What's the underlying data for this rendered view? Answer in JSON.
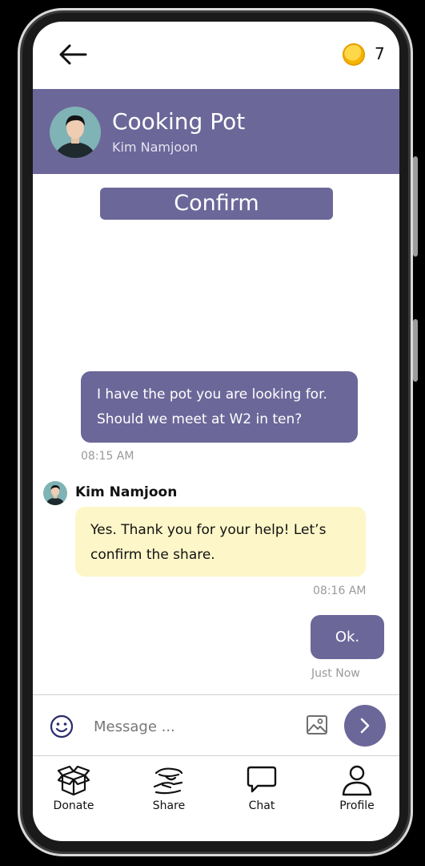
{
  "topbar": {
    "coin_count": "7"
  },
  "header": {
    "title": "Cooking Pot",
    "subtitle": "Kim Namjoon"
  },
  "confirm_label": "Confirm",
  "messages": {
    "m1": {
      "text": "I have the pot you are looking for. Should we meet at W2 in ten?",
      "time": "08:15 AM"
    },
    "m2": {
      "sender": "Kim Namjoon",
      "text": "Yes. Thank you for your help! Let’s confirm the share.",
      "time": "08:16 AM"
    },
    "m3": {
      "text": "Ok.",
      "time": "Just Now"
    }
  },
  "composer": {
    "placeholder": "Message ..."
  },
  "nav": {
    "items": [
      {
        "label": "Donate",
        "icon": "box-icon"
      },
      {
        "label": "Share",
        "icon": "hand-share-icon"
      },
      {
        "label": "Chat",
        "icon": "chat-bubble-icon"
      },
      {
        "label": "Profile",
        "icon": "user-icon"
      }
    ]
  },
  "colors": {
    "accent": "#6c6799",
    "incoming_bubble": "#fdf6c8",
    "coin": "#f5b400"
  }
}
